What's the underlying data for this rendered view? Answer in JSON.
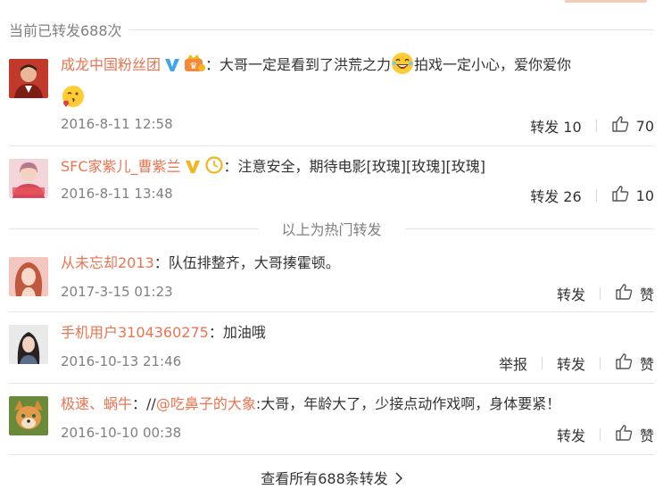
{
  "header": {
    "repost_count_text": "当前已转发688次"
  },
  "hot_section_label": "以上为热门转发",
  "hot_reposts": [
    {
      "user": "成龙中国粉丝团",
      "text_part1": "：大哥一定是看到了洪荒之力",
      "text_part2": "拍戏一定小心，爱你爱你",
      "date": "2016-8-11 12:58",
      "repost_label": "转发 10",
      "like_count": "70"
    },
    {
      "user": "SFC家紫儿_曹紫兰",
      "text": "：注意安全，期待电影[玫瑰][玫瑰][玫瑰]",
      "date": "2016-8-11 13:48",
      "repost_label": "转发 26",
      "like_count": "10"
    }
  ],
  "reposts": [
    {
      "user": "从未忘却2013",
      "text": "：队伍排整齐，大哥揍霍顿。",
      "date": "2017-3-15 01:23",
      "repost_label": "转发",
      "like_label": "赞"
    },
    {
      "user": "手机用户3104360275",
      "text": "：加油哦",
      "date": "2016-10-13 21:46",
      "report_label": "举报",
      "repost_label": "转发",
      "like_label": "赞"
    },
    {
      "user": "极速、蜗牛",
      "text_prefix": "：//",
      "mention": "@吃鼻子的大象",
      "text": ":大哥，年龄大了，少接点动作戏啊，身体要紧！",
      "date": "2016-10-10 00:38",
      "repost_label": "转发",
      "like_label": "赞"
    }
  ],
  "footer": {
    "view_all_label": "查看所有688条转发"
  },
  "colors": {
    "accent": "#eb7350",
    "muted": "#808080",
    "vip_blue": "#3fa6e8",
    "vip_gold": "#f2b51f"
  },
  "icons": [
    "verified-blue-icon",
    "verified-gold-icon",
    "vip-crown-icon",
    "clock-badge-icon",
    "laughing-emoji-icon",
    "kiss-emoji-icon",
    "thumbs-up-icon",
    "chevron-right-icon"
  ]
}
